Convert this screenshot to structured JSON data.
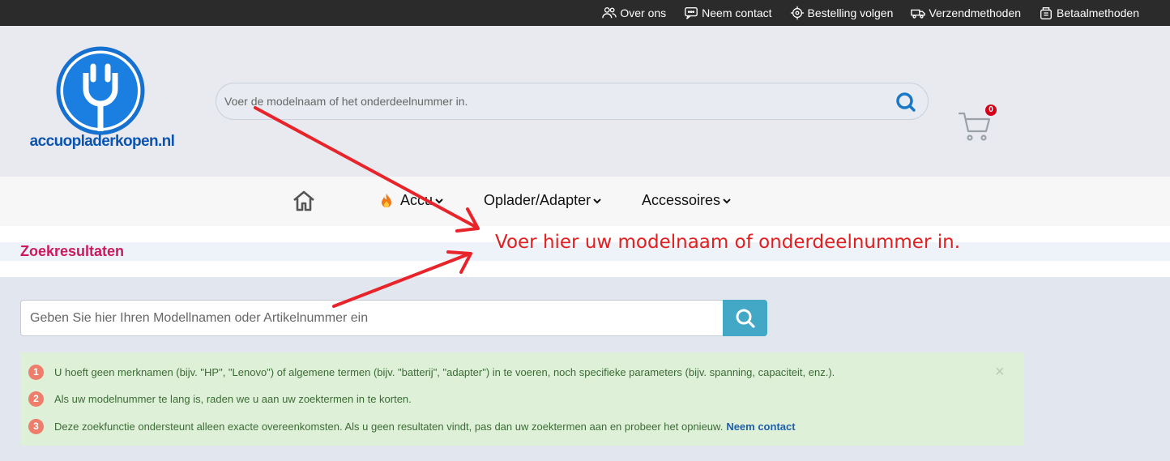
{
  "topbar": {
    "links": [
      {
        "label": "Over ons",
        "icon": "users-icon"
      },
      {
        "label": "Neem contact",
        "icon": "chat-icon"
      },
      {
        "label": "Bestelling volgen",
        "icon": "location-icon"
      },
      {
        "label": "Verzendmethoden",
        "icon": "truck-icon"
      },
      {
        "label": "Betaalmethoden",
        "icon": "wallet-icon"
      }
    ]
  },
  "header": {
    "logo_text": "accuopladerkopen.nl",
    "search_placeholder": "Voer de modelnaam of het onderdeelnummer in.",
    "cart_count": "0"
  },
  "nav": {
    "items": [
      {
        "label": "Accu"
      },
      {
        "label": "Oplader/Adapter"
      },
      {
        "label": "Accessoires"
      }
    ]
  },
  "results": {
    "title": "Zoekresultaten"
  },
  "main_search": {
    "placeholder": "Geben Sie hier Ihren Modellnamen oder Artikelnummer ein"
  },
  "info": {
    "items": [
      {
        "num": "1",
        "text": "U hoeft geen merknamen (bijv. \"HP\", \"Lenovo\") of algemene termen (bijv. \"batterij\", \"adapter\") in te voeren, noch specifieke parameters (bijv. spanning, capaciteit, enz.)."
      },
      {
        "num": "2",
        "text": "Als uw modelnummer te lang is, raden we u aan uw zoektermen in te korten."
      },
      {
        "num": "3",
        "text": "Deze zoekfunctie ondersteunt alleen exacte overeenkomsten. Als u geen resultaten vindt, pas dan uw zoektermen aan en probeer het opnieuw.",
        "link": "Neem contact"
      }
    ],
    "close_symbol": "×"
  },
  "annotation": {
    "text": "Voer hier uw modelnaam of onderdeelnummer in.",
    "color": "#e02020"
  },
  "colors": {
    "accent_pink": "#cc1a5a",
    "search_button": "#43a8c6",
    "info_bg": "#dff0d9",
    "badge_red": "#d4001a"
  }
}
